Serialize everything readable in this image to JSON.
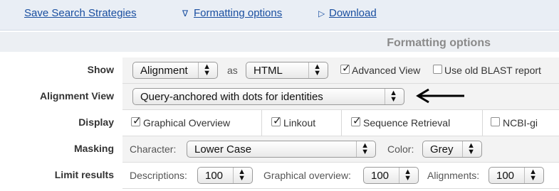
{
  "topnav": {
    "save_label": "Save Search Strategies",
    "formatting_label": "Formatting options",
    "download_label": "Download",
    "formatting_marker": "∇",
    "download_marker": "▷"
  },
  "panel": {
    "title": "Formatting options"
  },
  "show_row": {
    "label": "Show",
    "type_select": "Alignment",
    "as_text": "as",
    "format_select": "HTML",
    "advanced_view_label": "Advanced View",
    "advanced_view_checked": true,
    "old_blast_label": "Use old BLAST report",
    "old_blast_checked": false
  },
  "alignment_view_row": {
    "label": "Alignment View",
    "select_value": "Query-anchored with dots for identities"
  },
  "display_row": {
    "label": "Display",
    "graphical_overview_label": "Graphical Overview",
    "graphical_overview_checked": true,
    "linkout_label": "Linkout",
    "linkout_checked": true,
    "sequence_retrieval_label": "Sequence Retrieval",
    "sequence_retrieval_checked": true,
    "ncbi_gi_label": "NCBI-gi",
    "ncbi_gi_checked": false
  },
  "masking_row": {
    "label": "Masking",
    "character_label": "Character:",
    "character_select": "Lower Case",
    "color_label": "Color:",
    "color_select": "Grey"
  },
  "limit_row": {
    "label": "Limit results",
    "descriptions_label": "Descriptions:",
    "descriptions_value": "100",
    "graphical_overview_label": "Graphical overview:",
    "graphical_overview_value": "100",
    "alignments_label": "Alignments:",
    "alignments_value": "100"
  },
  "colors": {
    "link": "#1a4fa0",
    "topbar_bg": "#e9eef5",
    "alt_row_bg": "#f3f3f3"
  }
}
